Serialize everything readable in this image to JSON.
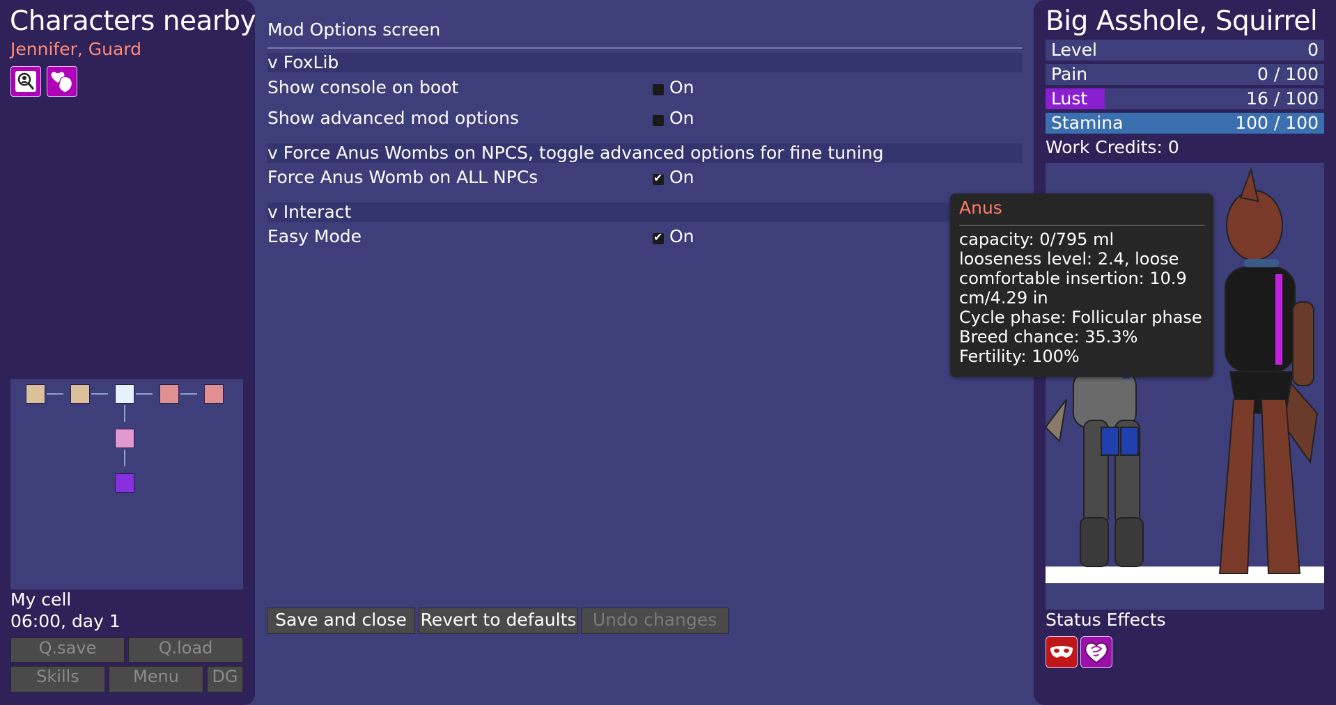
{
  "left": {
    "title": "Characters nearby",
    "nearby": "Jennifer, Guard",
    "icons": [
      "inspect-icon",
      "heart-hand-icon"
    ],
    "location": "My cell",
    "time": "06:00, day 1",
    "buttons": {
      "qsave": "Q.save",
      "qload": "Q.load",
      "skills": "Skills",
      "menu": "Menu",
      "dg": "DG"
    },
    "map_colors": {
      "tan": "#dcc09a",
      "current": "#e6f0ff",
      "pink": "#e09090",
      "lilac": "#e098d0",
      "purple": "#8830e0"
    }
  },
  "options": {
    "screen_title": "Mod Options screen",
    "sections": [
      {
        "header": "v FoxLib",
        "items": [
          {
            "label": "Show console on boot",
            "toggle": "On",
            "checked": false
          },
          {
            "label": "Show advanced mod options",
            "toggle": "On",
            "checked": false
          }
        ]
      },
      {
        "header": "v Force Anus Wombs on NPCS, toggle advanced options for fine tuning",
        "items": [
          {
            "label": "Force Anus Womb on ALL NPCs",
            "toggle": "On",
            "checked": true
          }
        ]
      },
      {
        "header": "v Interact",
        "items": [
          {
            "label": "Easy Mode",
            "toggle": "On",
            "checked": true
          }
        ]
      }
    ],
    "buttons": {
      "save": "Save and close",
      "revert": "Revert to defaults",
      "undo": "Undo changes"
    }
  },
  "right": {
    "name": "Big Asshole, Squirrel",
    "stats": [
      {
        "name": "Level",
        "value": "0",
        "fill": 0,
        "color": "#3e3e7a"
      },
      {
        "name": "Pain",
        "value": "0 / 100",
        "fill": 0,
        "color": "#c03030"
      },
      {
        "name": "Lust",
        "value": "16 / 100",
        "fill": 0.16,
        "color": "#8a1fd0"
      },
      {
        "name": "Stamina",
        "value": "100 / 100",
        "fill": 1.0,
        "color": "#3a6fb0"
      }
    ],
    "work_credits": "Work Credits: 0",
    "status_title": "Status Effects",
    "status_icons": [
      "mask-icon",
      "heart-swirl-icon"
    ]
  },
  "tooltip": {
    "title": "Anus",
    "lines": [
      "capacity: 0/795 ml",
      "looseness level: 2.4, loose",
      "comfortable insertion: 10.9",
      "cm/4.29 in",
      "Cycle phase: Follicular phase",
      "Breed chance: 35.3%",
      "Fertility: 100%"
    ]
  }
}
